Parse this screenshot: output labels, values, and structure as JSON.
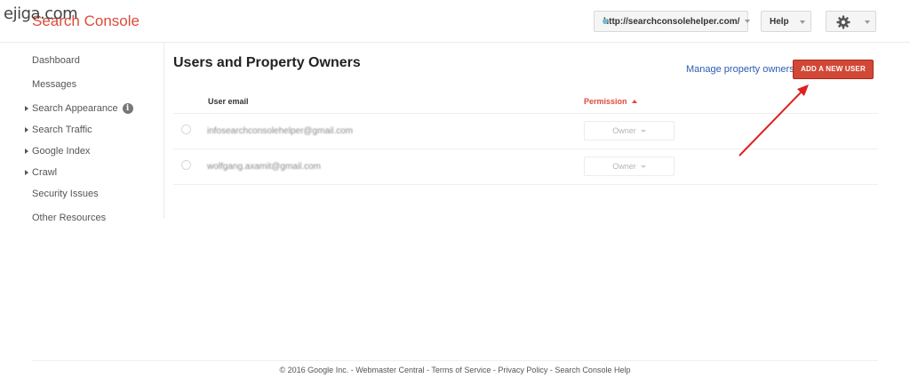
{
  "watermark": "ejiga.com",
  "app": {
    "title": "Search Console"
  },
  "header": {
    "site": "http://searchconsolehelper.com/",
    "help_label": "Help"
  },
  "sidebar": {
    "items": [
      {
        "label": "Dashboard",
        "expandable": false
      },
      {
        "label": "Messages",
        "expandable": false
      },
      {
        "label": "Search Appearance",
        "expandable": true,
        "info": "i"
      },
      {
        "label": "Search Traffic",
        "expandable": true
      },
      {
        "label": "Google Index",
        "expandable": true
      },
      {
        "label": "Crawl",
        "expandable": true
      },
      {
        "label": "Security Issues",
        "expandable": false
      },
      {
        "label": "Other Resources",
        "expandable": false
      }
    ]
  },
  "main": {
    "title": "Users and Property Owners",
    "manage_link": "Manage property owners",
    "add_button": "ADD A NEW USER",
    "table": {
      "columns": [
        "User email",
        "Permission"
      ],
      "sort": "Permission ascending",
      "rows": [
        {
          "email": "infosearchconsolehelper@gmail.com",
          "permission": "Owner"
        },
        {
          "email": "wolfgang.axamit@gmail.com",
          "permission": "Owner"
        }
      ]
    }
  },
  "footer": {
    "text": "© 2016 Google Inc. - Webmaster Central - Terms of Service - Privacy Policy - Search Console Help"
  },
  "colors": {
    "brand": "#dd4b39",
    "primary_button": "#d14836",
    "link": "#2a5db0",
    "annotation_arrow": "#e02020"
  }
}
